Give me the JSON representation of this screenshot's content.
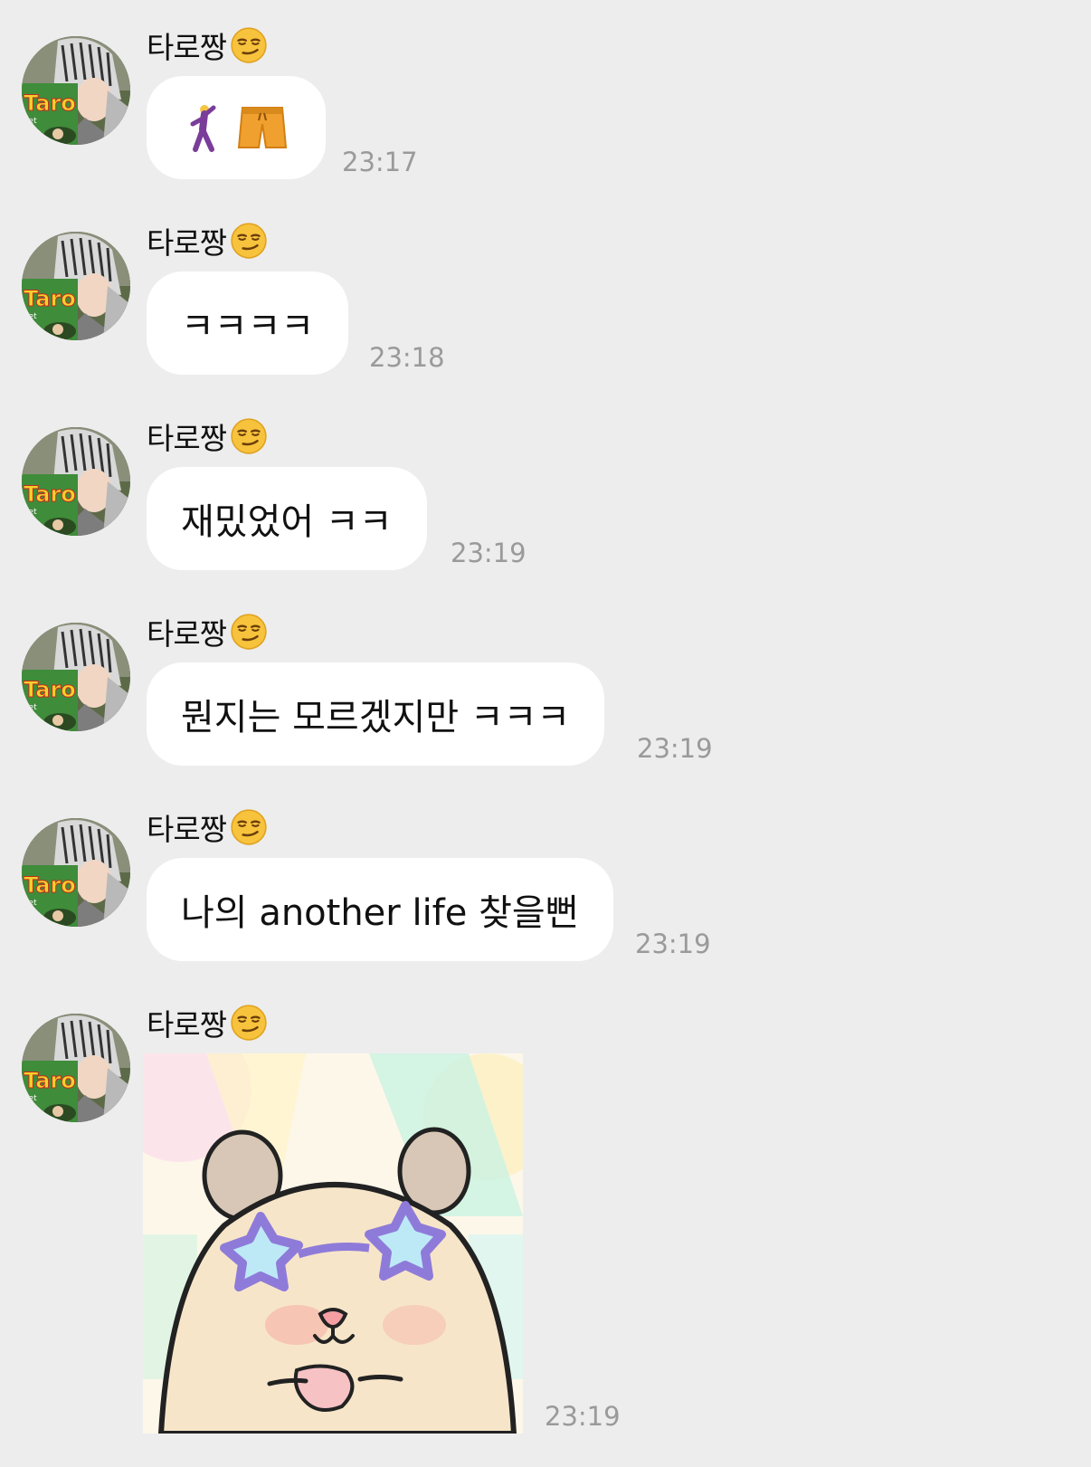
{
  "sender": {
    "name": "타로짱",
    "name_emoji_icon": "smirking-face-icon",
    "avatar_icon": "profile-photo-avatar"
  },
  "messages": [
    {
      "type": "emoji",
      "icons": [
        "dancing-man-icon",
        "shorts-icon"
      ],
      "time": "23:17"
    },
    {
      "type": "text",
      "text": "ㅋㅋㅋㅋ",
      "time": "23:18"
    },
    {
      "type": "text",
      "text": "재밌었어 ㅋㅋ",
      "time": "23:19"
    },
    {
      "type": "text",
      "text": "뭔지는 모르겠지만 ㅋㅋㅋ",
      "time": "23:19"
    },
    {
      "type": "text",
      "text": "나의 another life 찾을뻔",
      "time": "23:19"
    },
    {
      "type": "sticker",
      "icon": "hamster-star-sunglasses-sticker",
      "time": "23:19"
    }
  ],
  "colors": {
    "background": "#ededed",
    "bubble": "#ffffff",
    "timestamp": "#9a9a9a"
  }
}
